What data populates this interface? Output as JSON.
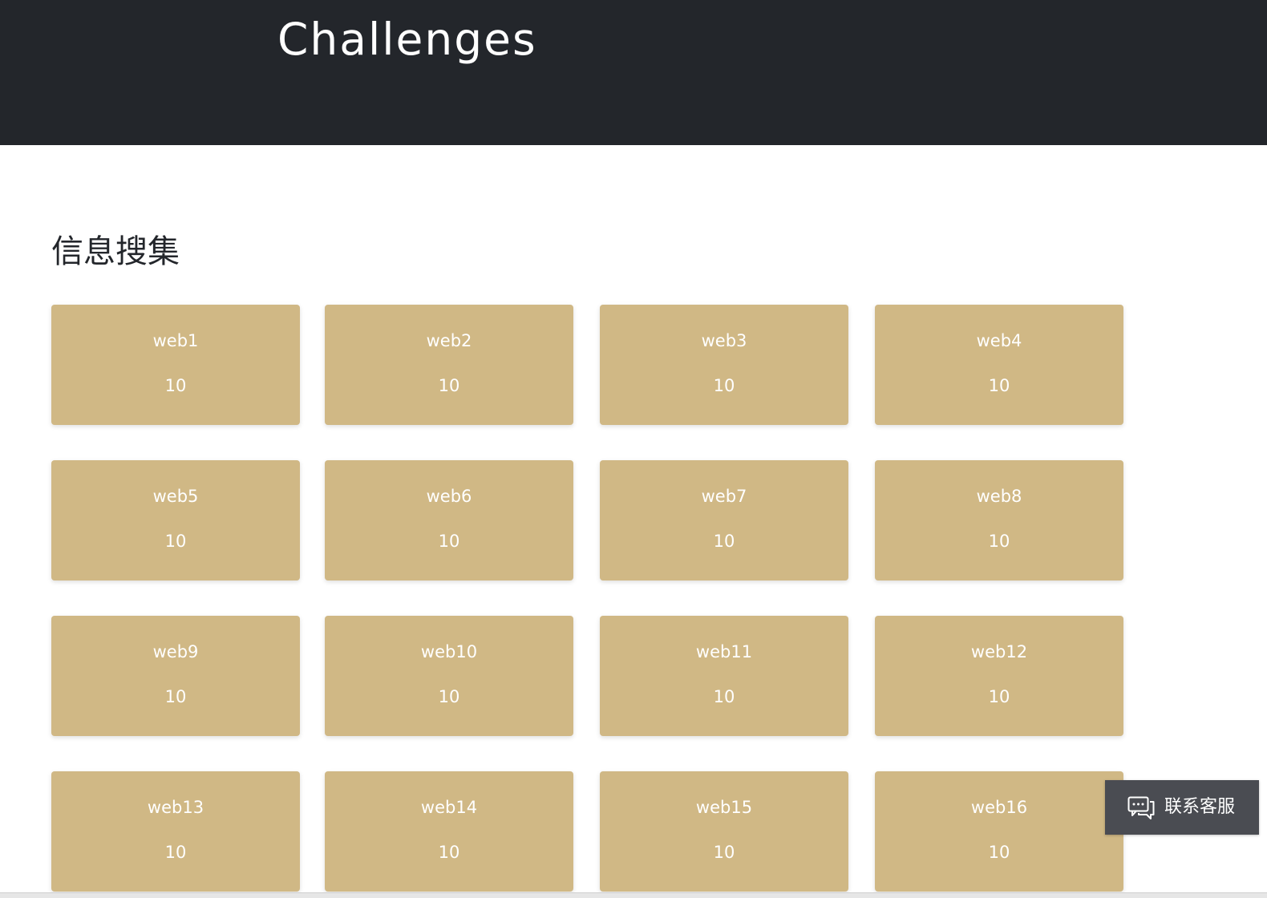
{
  "header": {
    "title": "Challenges"
  },
  "category": {
    "title": "信息搜集",
    "challenges": [
      {
        "name": "web1",
        "points": "10"
      },
      {
        "name": "web2",
        "points": "10"
      },
      {
        "name": "web3",
        "points": "10"
      },
      {
        "name": "web4",
        "points": "10"
      },
      {
        "name": "web5",
        "points": "10"
      },
      {
        "name": "web6",
        "points": "10"
      },
      {
        "name": "web7",
        "points": "10"
      },
      {
        "name": "web8",
        "points": "10"
      },
      {
        "name": "web9",
        "points": "10"
      },
      {
        "name": "web10",
        "points": "10"
      },
      {
        "name": "web11",
        "points": "10"
      },
      {
        "name": "web12",
        "points": "10"
      },
      {
        "name": "web13",
        "points": "10"
      },
      {
        "name": "web14",
        "points": "10"
      },
      {
        "name": "web15",
        "points": "10"
      },
      {
        "name": "web16",
        "points": "10"
      }
    ]
  },
  "support": {
    "label": "联系客服",
    "icon": "chat-bubbles-icon"
  },
  "colors": {
    "header_bg": "#23262b",
    "card_bg": "#d0b885",
    "support_bg": "#4a4c52"
  }
}
